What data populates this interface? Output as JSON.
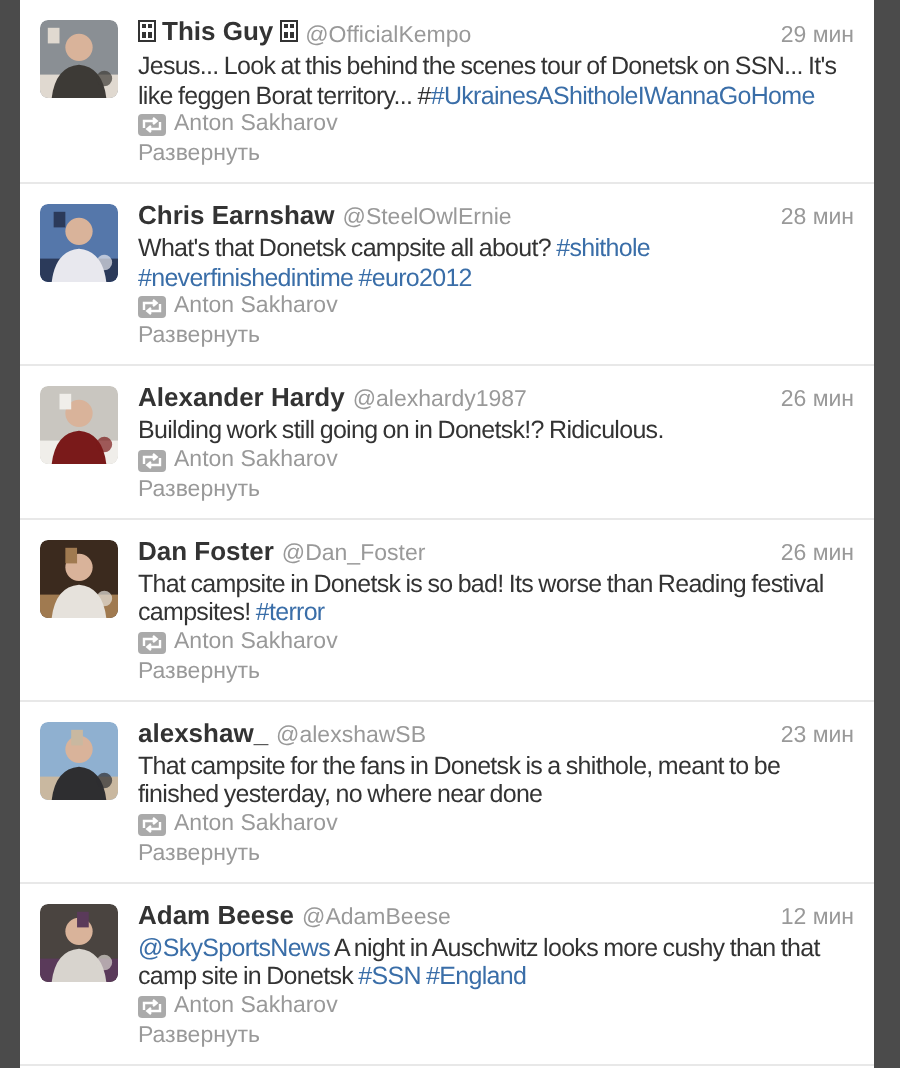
{
  "tweets": [
    {
      "name": "This Guy",
      "name_glyph_boxes": true,
      "handle": "@OfficialKempo",
      "time": "29 мин",
      "text": [
        {
          "kind": "plain",
          "text": "Jesus... Look at this behind the scenes tour of Donetsk on SSN... It's like feggen Borat territory... #"
        },
        {
          "kind": "link",
          "text": "#UkrainesAShitholeIWannaGoHome"
        }
      ],
      "retweeted_by": "Anton Sakharov",
      "expand": "Развернуть"
    },
    {
      "name": "Chris Earnshaw",
      "name_glyph_boxes": false,
      "handle": "@SteelOwlErnie",
      "time": "28 мин",
      "text": [
        {
          "kind": "plain",
          "text": "What's that Donetsk campsite all about? "
        },
        {
          "kind": "link",
          "text": "#shithole"
        },
        {
          "kind": "link",
          "text": "#neverfinishedintime"
        },
        {
          "kind": "link",
          "text": "#euro2012"
        }
      ],
      "retweeted_by": "Anton Sakharov",
      "expand": "Развернуть"
    },
    {
      "name": "Alexander Hardy",
      "name_glyph_boxes": false,
      "handle": "@alexhardy1987",
      "time": "26 мин",
      "text": [
        {
          "kind": "plain",
          "text": "Building work still going on in Donetsk!? Ridiculous."
        }
      ],
      "retweeted_by": "Anton Sakharov",
      "expand": "Развернуть"
    },
    {
      "name": "Dan Foster",
      "name_glyph_boxes": false,
      "handle": "@Dan_Foster",
      "time": "26 мин",
      "text": [
        {
          "kind": "plain",
          "text": "That campsite in Donetsk is so bad! Its worse than Reading festival campsites! "
        },
        {
          "kind": "link",
          "text": "#terror"
        }
      ],
      "retweeted_by": "Anton Sakharov",
      "expand": "Развернуть"
    },
    {
      "name": "alexshaw_",
      "name_glyph_boxes": false,
      "handle": "@alexshawSB",
      "time": "23 мин",
      "text": [
        {
          "kind": "plain",
          "text": "That campsite for the fans in Donetsk is a shithole, meant to be finished yesterday, no where near done"
        }
      ],
      "retweeted_by": "Anton Sakharov",
      "expand": "Развернуть"
    },
    {
      "name": "Adam Beese",
      "name_glyph_boxes": false,
      "handle": "@AdamBeese",
      "time": "12 мин",
      "text": [
        {
          "kind": "link",
          "text": "@SkySportsNews"
        },
        {
          "kind": "plain",
          "text": " A night in Auschwitz looks more cushy than that camp site in Donetsk "
        },
        {
          "kind": "link",
          "text": "#SSN"
        },
        {
          "kind": "link",
          "text": "#England"
        }
      ],
      "retweeted_by": "Anton Sakharov",
      "expand": "Развернуть"
    }
  ]
}
